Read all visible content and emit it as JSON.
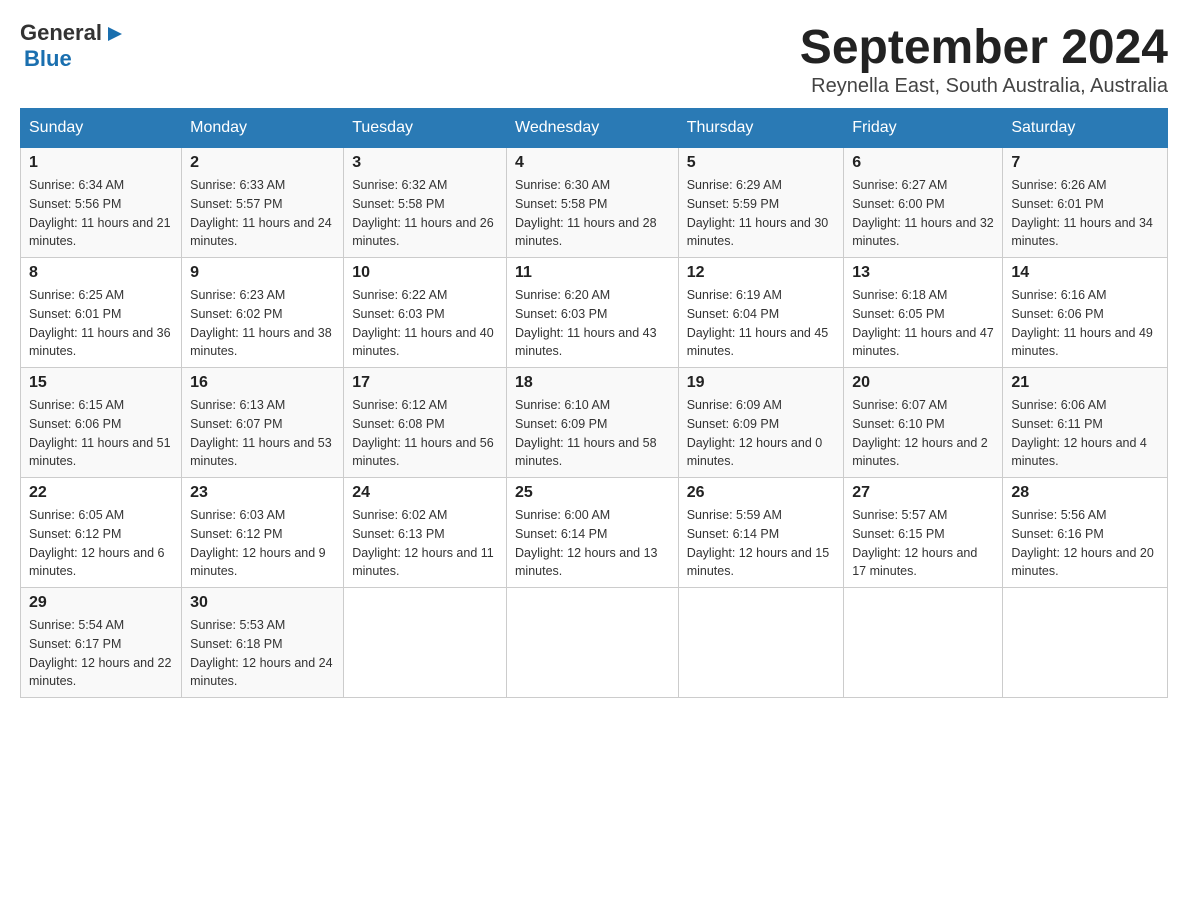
{
  "logo": {
    "general": "General",
    "blue": "Blue"
  },
  "title": "September 2024",
  "location": "Reynella East, South Australia, Australia",
  "headers": [
    "Sunday",
    "Monday",
    "Tuesday",
    "Wednesday",
    "Thursday",
    "Friday",
    "Saturday"
  ],
  "weeks": [
    [
      {
        "day": "1",
        "sunrise": "6:34 AM",
        "sunset": "5:56 PM",
        "daylight": "11 hours and 21 minutes."
      },
      {
        "day": "2",
        "sunrise": "6:33 AM",
        "sunset": "5:57 PM",
        "daylight": "11 hours and 24 minutes."
      },
      {
        "day": "3",
        "sunrise": "6:32 AM",
        "sunset": "5:58 PM",
        "daylight": "11 hours and 26 minutes."
      },
      {
        "day": "4",
        "sunrise": "6:30 AM",
        "sunset": "5:58 PM",
        "daylight": "11 hours and 28 minutes."
      },
      {
        "day": "5",
        "sunrise": "6:29 AM",
        "sunset": "5:59 PM",
        "daylight": "11 hours and 30 minutes."
      },
      {
        "day": "6",
        "sunrise": "6:27 AM",
        "sunset": "6:00 PM",
        "daylight": "11 hours and 32 minutes."
      },
      {
        "day": "7",
        "sunrise": "6:26 AM",
        "sunset": "6:01 PM",
        "daylight": "11 hours and 34 minutes."
      }
    ],
    [
      {
        "day": "8",
        "sunrise": "6:25 AM",
        "sunset": "6:01 PM",
        "daylight": "11 hours and 36 minutes."
      },
      {
        "day": "9",
        "sunrise": "6:23 AM",
        "sunset": "6:02 PM",
        "daylight": "11 hours and 38 minutes."
      },
      {
        "day": "10",
        "sunrise": "6:22 AM",
        "sunset": "6:03 PM",
        "daylight": "11 hours and 40 minutes."
      },
      {
        "day": "11",
        "sunrise": "6:20 AM",
        "sunset": "6:03 PM",
        "daylight": "11 hours and 43 minutes."
      },
      {
        "day": "12",
        "sunrise": "6:19 AM",
        "sunset": "6:04 PM",
        "daylight": "11 hours and 45 minutes."
      },
      {
        "day": "13",
        "sunrise": "6:18 AM",
        "sunset": "6:05 PM",
        "daylight": "11 hours and 47 minutes."
      },
      {
        "day": "14",
        "sunrise": "6:16 AM",
        "sunset": "6:06 PM",
        "daylight": "11 hours and 49 minutes."
      }
    ],
    [
      {
        "day": "15",
        "sunrise": "6:15 AM",
        "sunset": "6:06 PM",
        "daylight": "11 hours and 51 minutes."
      },
      {
        "day": "16",
        "sunrise": "6:13 AM",
        "sunset": "6:07 PM",
        "daylight": "11 hours and 53 minutes."
      },
      {
        "day": "17",
        "sunrise": "6:12 AM",
        "sunset": "6:08 PM",
        "daylight": "11 hours and 56 minutes."
      },
      {
        "day": "18",
        "sunrise": "6:10 AM",
        "sunset": "6:09 PM",
        "daylight": "11 hours and 58 minutes."
      },
      {
        "day": "19",
        "sunrise": "6:09 AM",
        "sunset": "6:09 PM",
        "daylight": "12 hours and 0 minutes."
      },
      {
        "day": "20",
        "sunrise": "6:07 AM",
        "sunset": "6:10 PM",
        "daylight": "12 hours and 2 minutes."
      },
      {
        "day": "21",
        "sunrise": "6:06 AM",
        "sunset": "6:11 PM",
        "daylight": "12 hours and 4 minutes."
      }
    ],
    [
      {
        "day": "22",
        "sunrise": "6:05 AM",
        "sunset": "6:12 PM",
        "daylight": "12 hours and 6 minutes."
      },
      {
        "day": "23",
        "sunrise": "6:03 AM",
        "sunset": "6:12 PM",
        "daylight": "12 hours and 9 minutes."
      },
      {
        "day": "24",
        "sunrise": "6:02 AM",
        "sunset": "6:13 PM",
        "daylight": "12 hours and 11 minutes."
      },
      {
        "day": "25",
        "sunrise": "6:00 AM",
        "sunset": "6:14 PM",
        "daylight": "12 hours and 13 minutes."
      },
      {
        "day": "26",
        "sunrise": "5:59 AM",
        "sunset": "6:14 PM",
        "daylight": "12 hours and 15 minutes."
      },
      {
        "day": "27",
        "sunrise": "5:57 AM",
        "sunset": "6:15 PM",
        "daylight": "12 hours and 17 minutes."
      },
      {
        "day": "28",
        "sunrise": "5:56 AM",
        "sunset": "6:16 PM",
        "daylight": "12 hours and 20 minutes."
      }
    ],
    [
      {
        "day": "29",
        "sunrise": "5:54 AM",
        "sunset": "6:17 PM",
        "daylight": "12 hours and 22 minutes."
      },
      {
        "day": "30",
        "sunrise": "5:53 AM",
        "sunset": "6:18 PM",
        "daylight": "12 hours and 24 minutes."
      },
      null,
      null,
      null,
      null,
      null
    ]
  ]
}
